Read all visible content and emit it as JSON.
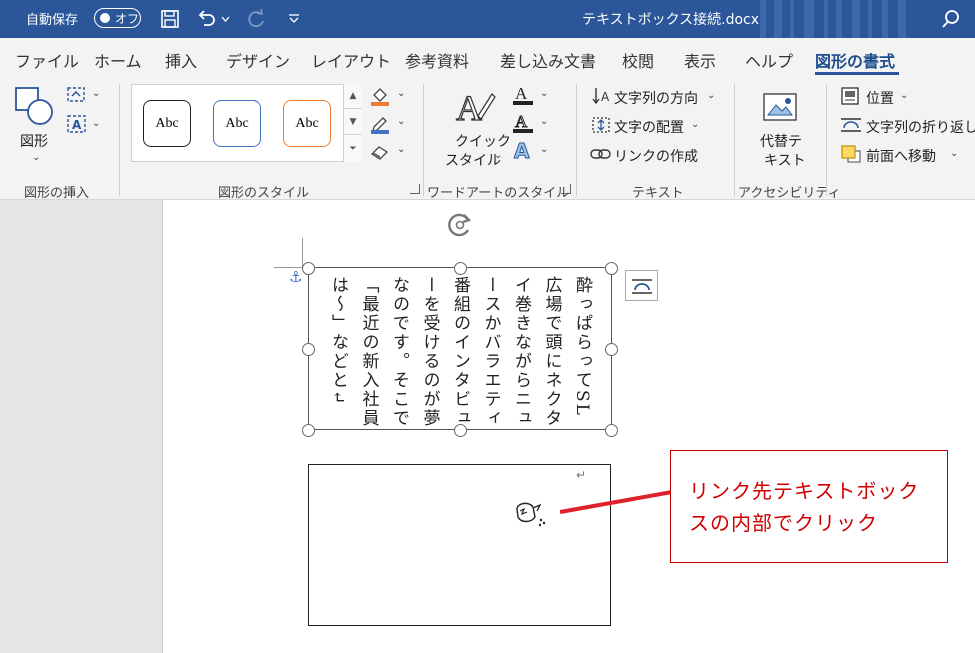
{
  "titlebar": {
    "autosave_label": "自動保存",
    "autosave_state": "オフ",
    "document_title": "テキストボックス接続.docx"
  },
  "tabs": [
    "ファイル",
    "ホーム",
    "挿入",
    "デザイン",
    "レイアウト",
    "参考資料",
    "差し込み文書",
    "校閲",
    "表示",
    "ヘルプ",
    "図形の書式"
  ],
  "active_tab": "図形の書式",
  "ribbon": {
    "insert_shapes": {
      "shapes_label": "図形",
      "group_label": "図形の挿入"
    },
    "shape_styles": {
      "sample_label": "Abc",
      "group_label": "図形のスタイル"
    },
    "wordart": {
      "quick_style_line1": "クイック",
      "quick_style_line2": "スタイル",
      "group_label": "ワードアートのスタイル"
    },
    "text": {
      "direction": "文字列の方向",
      "align": "文字の配置",
      "create_link": "リンクの作成",
      "group_label": "テキスト"
    },
    "accessibility": {
      "alt_text_line1": "代替テ",
      "alt_text_line2": "キスト",
      "group_label": "アクセシビリティ"
    },
    "arrange": {
      "position": "位置",
      "wrap": "文字列の折り返し",
      "bring_forward": "前面へ移動"
    }
  },
  "document": {
    "textbox1_lines": [
      "酔っぱらってSL",
      "広場で頭にネクタ",
      "イ巻きながらニュ",
      "ースかバラエティ",
      "番組のインタビュ",
      "ーを受けるのが夢",
      "なのです。そこで",
      "「最近の新入社員",
      "は～」などと↵"
    ],
    "textbox2_mark": "↵"
  },
  "callout": {
    "text": "リンク先テキストボックスの内部でクリック"
  },
  "colors": {
    "title_bar": "#2b579a",
    "accent_red": "#d00000"
  }
}
